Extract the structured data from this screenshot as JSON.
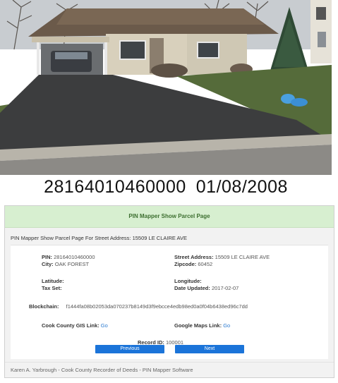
{
  "photo": {
    "parcel_number": "28164010460000",
    "photo_date": "01/08/2008"
  },
  "panel": {
    "heading": "PIN Mapper Show Parcel Page",
    "subheading": "PIN Mapper Show Parcel Page For Street Address: 15509 LE CLAIRE AVE",
    "pin_label": "PIN:",
    "pin_value": "28164010460000",
    "city_label": "City:",
    "city_value": "OAK FOREST",
    "street_label": "Street Address:",
    "street_value": "15509 LE CLAIRE AVE",
    "zip_label": "Zipcode:",
    "zip_value": "60452",
    "latitude_label": "Latitude:",
    "longitude_label": "Longitude:",
    "taxset_label": "Tax Set:",
    "date_updated_label": "Date Updated:",
    "date_updated_value": "2017-02-07",
    "blockchain_label": "Blockchain:",
    "blockchain_value": "f1444fa08b02053da070237b8149d3f9ebcce4edb98ed0a0f04b6438ed96c7dd",
    "gis_label": "Cook County GIS Link:",
    "gis_link": "Go",
    "maps_label": "Google Maps Link:",
    "maps_link": "Go",
    "record_label": "Record ID:",
    "record_value": "100001",
    "previous_button": "Previous",
    "next_button": "Next",
    "footer": "Karen A. Yarbrough - Cook County Recorder of Deeds - PIN Mapper Software"
  }
}
